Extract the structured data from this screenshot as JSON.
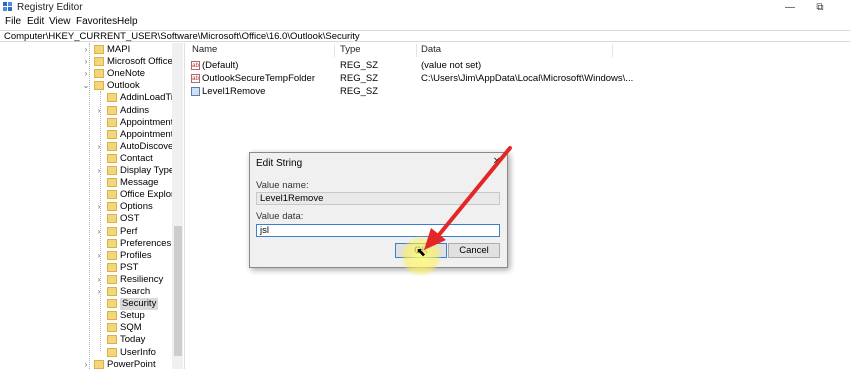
{
  "window": {
    "title": "Registry Editor",
    "minimize": "—",
    "restore": "⧉",
    "close": "✕"
  },
  "menu": [
    "File",
    "Edit",
    "View",
    "Favorites",
    "Help"
  ],
  "address": "Computer\\HKEY_CURRENT_USER\\Software\\Microsoft\\Office\\16.0\\Outlook\\Security",
  "tree": {
    "items": [
      {
        "label": "MAPI",
        "arrow": "›",
        "level": 1
      },
      {
        "label": "Microsoft Office H",
        "arrow": "›",
        "level": 1
      },
      {
        "label": "OneNote",
        "arrow": "›",
        "level": 1
      },
      {
        "label": "Outlook",
        "arrow": "⌄",
        "level": 1
      },
      {
        "label": "AddinLoadTim",
        "arrow": "",
        "level": 2
      },
      {
        "label": "Addins",
        "arrow": "›",
        "level": 2
      },
      {
        "label": "Appointment",
        "arrow": "",
        "level": 2
      },
      {
        "label": "Appointment",
        "arrow": "",
        "level": 2
      },
      {
        "label": "AutoDiscover",
        "arrow": "›",
        "level": 2
      },
      {
        "label": "Contact",
        "arrow": "",
        "level": 2
      },
      {
        "label": "Display Types",
        "arrow": "›",
        "level": 2
      },
      {
        "label": "Message",
        "arrow": "",
        "level": 2
      },
      {
        "label": "Office Explorer",
        "arrow": "",
        "level": 2
      },
      {
        "label": "Options",
        "arrow": "›",
        "level": 2
      },
      {
        "label": "OST",
        "arrow": "",
        "level": 2
      },
      {
        "label": "Perf",
        "arrow": "›",
        "level": 2
      },
      {
        "label": "Preferences",
        "arrow": "",
        "level": 2
      },
      {
        "label": "Profiles",
        "arrow": "›",
        "level": 2
      },
      {
        "label": "PST",
        "arrow": "",
        "level": 2
      },
      {
        "label": "Resiliency",
        "arrow": "›",
        "level": 2
      },
      {
        "label": "Search",
        "arrow": "›",
        "level": 2
      },
      {
        "label": "Security",
        "arrow": "",
        "level": 2,
        "selected": true
      },
      {
        "label": "Setup",
        "arrow": "",
        "level": 2
      },
      {
        "label": "SQM",
        "arrow": "",
        "level": 2
      },
      {
        "label": "Today",
        "arrow": "",
        "level": 2
      },
      {
        "label": "UserInfo",
        "arrow": "",
        "level": 2
      },
      {
        "label": "PowerPoint",
        "arrow": "›",
        "level": 1
      }
    ]
  },
  "values": {
    "headers": {
      "name": "Name",
      "type": "Type",
      "data": "Data"
    },
    "rows": [
      {
        "icon": "string-value-icon",
        "name": "(Default)",
        "type": "REG_SZ",
        "data": "(value not set)"
      },
      {
        "icon": "string-value-icon",
        "name": "OutlookSecureTempFolder",
        "type": "REG_SZ",
        "data": "C:\\Users\\Jim\\AppData\\Local\\Microsoft\\Windows\\..."
      },
      {
        "icon": "binary-value-icon",
        "name": "Level1Remove",
        "type": "REG_SZ",
        "data": ""
      }
    ]
  },
  "dialog": {
    "title": "Edit String",
    "close": "✕",
    "value_name_label": "Value name:",
    "value_name": "Level1Remove",
    "value_data_label": "Value data:",
    "value_data": "jsl",
    "ok": "OK",
    "cancel": "Cancel"
  },
  "annotation": {
    "arrow_color": "#e32626",
    "highlight_color": "#fff27a"
  }
}
